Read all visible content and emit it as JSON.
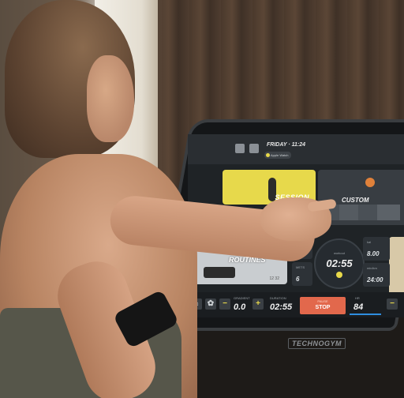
{
  "screen": {
    "day": "FRIDAY · 11:24",
    "watch_label": "Apple Watch",
    "session_label": "SESSION",
    "custom_label": "CUSTOM",
    "routines_label": "ROUTINES",
    "routines_nums": "12  32",
    "metrics": {
      "hr_label": "HR",
      "hr_value": "6",
      "mets_label": "METS",
      "mets_value": "6",
      "kcal_label": "kal",
      "kcal_value": "8.00",
      "pace_label": "min/km",
      "pace_value": "24:00",
      "time_label": "workout",
      "time_value": "02:55"
    },
    "bottom": {
      "gradient_label": "GRADIENT",
      "gradient_value": "0.0",
      "duration_label": "DURATION",
      "duration_value": "02:55",
      "pause_label": "PAUSE",
      "stop_label": "STOP",
      "hr_label": "HR",
      "hr_value": "84",
      "minus": "−",
      "plus": "+"
    }
  },
  "brand": "TECHNOGYM"
}
